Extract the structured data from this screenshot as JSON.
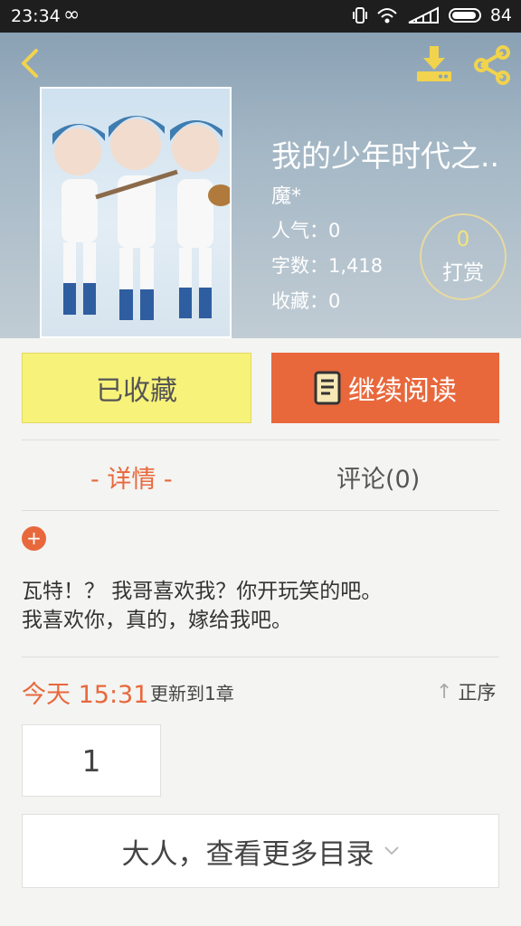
{
  "status_bar": {
    "time": "23:34",
    "battery": "84"
  },
  "book": {
    "title": "我的少年时代之..",
    "author": "魔*",
    "popularity_label": "人气：",
    "popularity": "0",
    "words_label": "字数：",
    "words": "1,418",
    "favorites_label": "收藏：",
    "favorites": "0",
    "tip_count": "0",
    "tip_label": "打赏"
  },
  "actions": {
    "favorited_label": "已收藏",
    "continue_label": "继续阅读"
  },
  "tabs": [
    {
      "label": "- 详情 -",
      "active": true
    },
    {
      "label": "评论(0)",
      "active": false
    }
  ],
  "description": {
    "line1": "瓦特！？ 我哥喜欢我？你开玩笑的吧。",
    "line2": "我喜欢你，真的，嫁给我吧。"
  },
  "update": {
    "day": "今天 15:31",
    "text": "更新到1章",
    "sort_label": "正序"
  },
  "chapters": [
    "1"
  ],
  "more_catalog_label": "大人，查看更多目录",
  "colors": {
    "accent": "#e8683c",
    "favorited_bg": "#f7f27a",
    "header_icon": "#f1d34d"
  },
  "icons": [
    "back-arrow-icon",
    "download-icon",
    "share-icon",
    "book-icon",
    "plus-icon",
    "sort-up-arrow-icon",
    "chevron-down-icon"
  ]
}
